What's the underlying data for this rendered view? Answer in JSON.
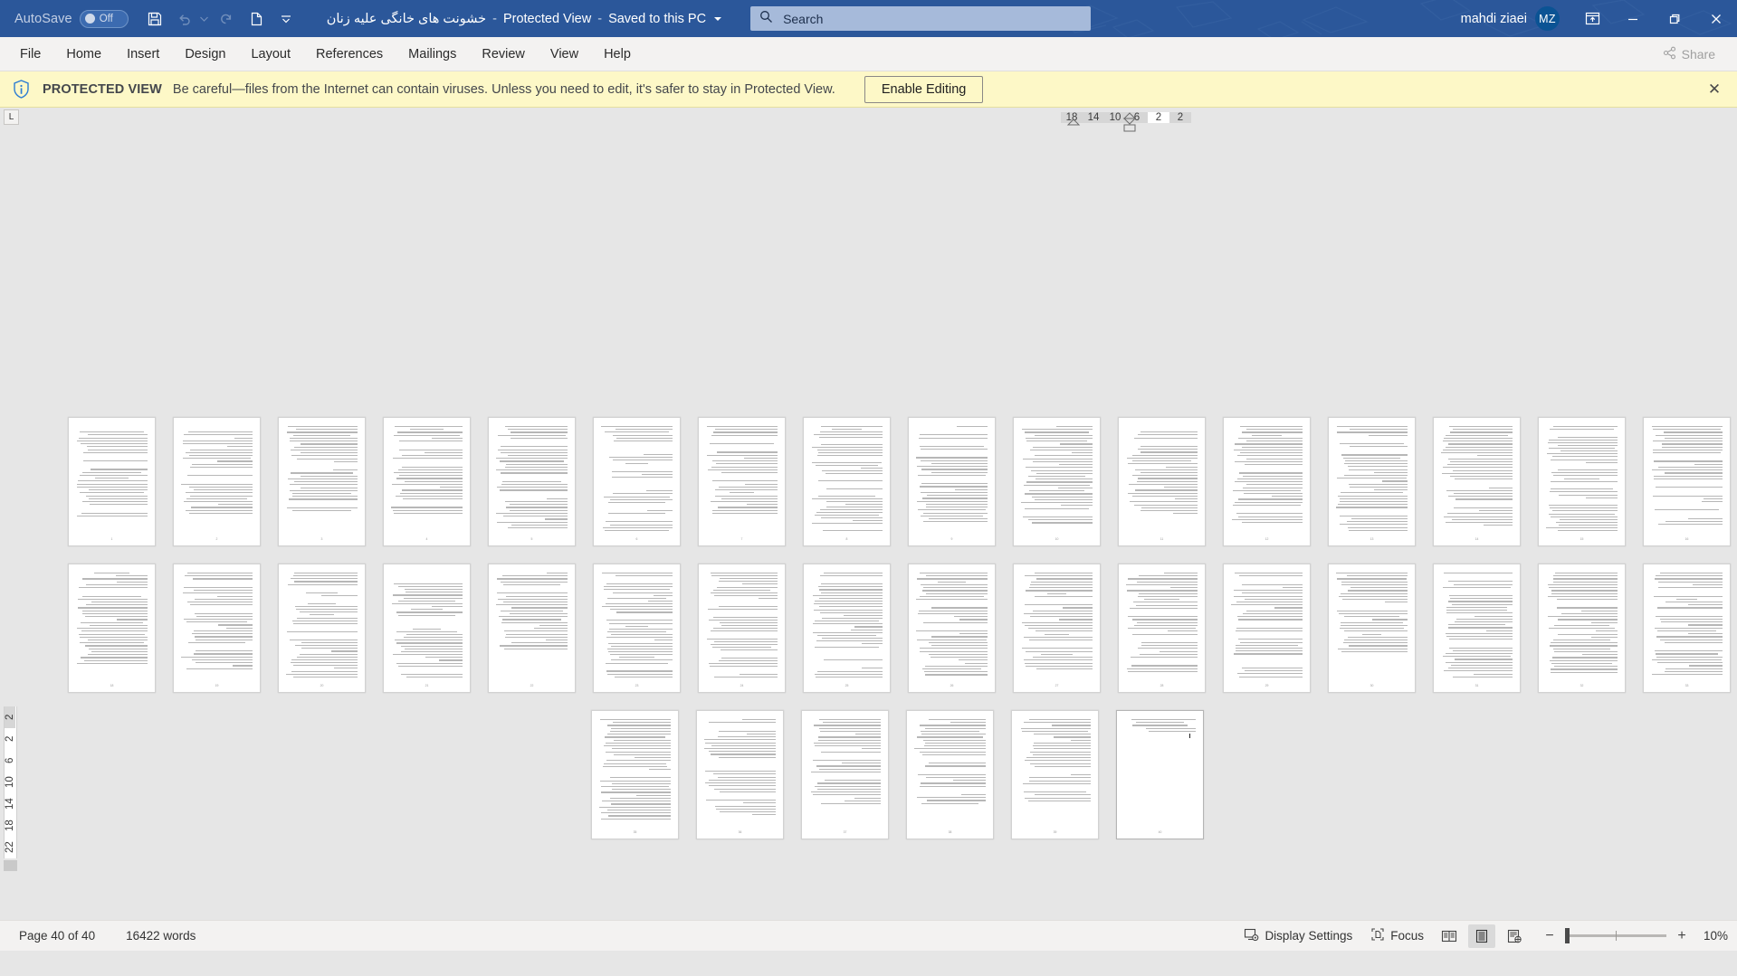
{
  "titlebar": {
    "autosave_label": "AutoSave",
    "autosave_state": "Off",
    "document_name": "خشونت های خانگی علیه زنان",
    "sep1": "-",
    "protected_view": "Protected View",
    "sep2": "-",
    "save_location": "Saved to this PC",
    "quick_access": [
      {
        "name": "save-icon",
        "label": "Save"
      },
      {
        "name": "undo-icon",
        "label": "Undo"
      },
      {
        "name": "redo-icon",
        "label": "Redo"
      },
      {
        "name": "new-document-icon",
        "label": "New"
      },
      {
        "name": "customize-quick-access-toolbar-icon",
        "label": "Customize Quick Access Toolbar"
      }
    ],
    "search_placeholder": "Search",
    "user_name": "mahdi ziaei",
    "avatar_initials": "MZ",
    "ribbon_display_options": "Ribbon Display Options",
    "minimize": "Minimize",
    "restore": "Restore Down",
    "close": "Close"
  },
  "ribbon": {
    "tabs": [
      {
        "label": "File"
      },
      {
        "label": "Home"
      },
      {
        "label": "Insert"
      },
      {
        "label": "Design"
      },
      {
        "label": "Layout"
      },
      {
        "label": "References"
      },
      {
        "label": "Mailings"
      },
      {
        "label": "Review"
      },
      {
        "label": "View"
      },
      {
        "label": "Help"
      }
    ],
    "share_label": "Share"
  },
  "protected_view_bar": {
    "icon": "info-shield-icon",
    "title": "PROTECTED VIEW",
    "message": "Be careful—files from the Internet can contain viruses. Unless you need to edit, it's safer to stay in Protected View.",
    "button_label": "Enable Editing",
    "close_label": "✕"
  },
  "rulers": {
    "tab_stop_marker": "L",
    "horizontal_numbers": [
      "18",
      "14",
      "10",
      "6",
      "2",
      "2"
    ],
    "vertical_numbers": [
      "2",
      "2",
      "6",
      "10",
      "14",
      "18",
      "22"
    ]
  },
  "document": {
    "total_pages": 40,
    "rows": [
      {
        "count": 17,
        "centered": false
      },
      {
        "count": 17,
        "centered": false
      },
      {
        "count": 6,
        "centered": true
      }
    ]
  },
  "statusbar": {
    "page_indicator": "Page 40 of 40",
    "word_count": "16422 words",
    "display_settings": "Display Settings",
    "focus": "Focus",
    "view_read_mode": "Read Mode",
    "view_print_layout": "Print Layout",
    "view_web_layout": "Web Layout",
    "zoom_out": "−",
    "zoom_in": "+",
    "zoom_level": "10%"
  },
  "colors": {
    "titlebar": "#2b579a",
    "ribbon": "#f3f2f1",
    "protected_bar": "#fdf8c7",
    "canvas": "#e6e6e6",
    "accent": "#0b5394"
  }
}
